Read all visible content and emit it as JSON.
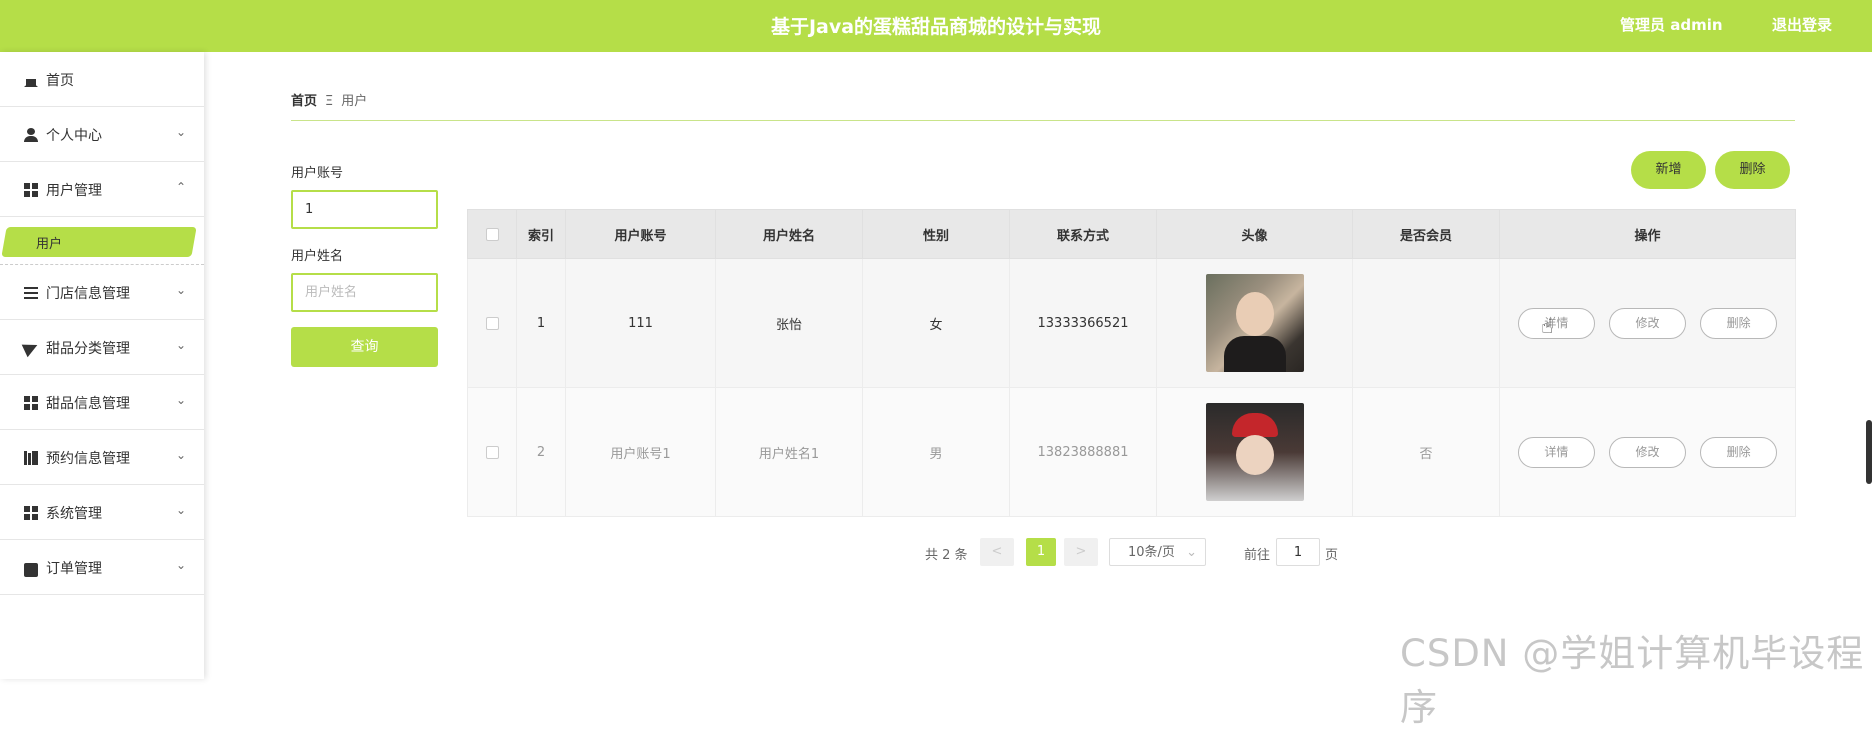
{
  "header": {
    "title": "基于Java的蛋糕甜品商城的设计与实现",
    "user": "管理员 admin",
    "logout": "退出登录",
    "accent": "#b5de48"
  },
  "sidebar": {
    "items": [
      {
        "label": "首页",
        "icon": "home-icon"
      },
      {
        "label": "个人中心",
        "icon": "user-icon"
      },
      {
        "label": "用户管理",
        "icon": "grid-icon"
      },
      {
        "label": "门店信息管理",
        "icon": "list-icon"
      },
      {
        "label": "甜品分类管理",
        "icon": "send-icon"
      },
      {
        "label": "甜品信息管理",
        "icon": "grid-icon"
      },
      {
        "label": "预约信息管理",
        "icon": "book-icon"
      },
      {
        "label": "系统管理",
        "icon": "grid-icon"
      },
      {
        "label": "订单管理",
        "icon": "ticket-icon"
      }
    ],
    "sub_active": "用户"
  },
  "breadcrumb": {
    "home": "首页",
    "current": "用户"
  },
  "search": {
    "account_label": "用户账号",
    "account_value": "1",
    "name_label": "用户姓名",
    "name_placeholder": "用户姓名",
    "button": "查询"
  },
  "actions": {
    "add": "新增",
    "delete": "删除"
  },
  "table": {
    "headers": [
      "索引",
      "用户账号",
      "用户姓名",
      "性别",
      "联系方式",
      "头像",
      "是否会员",
      "操作"
    ],
    "rows": [
      {
        "index": "1",
        "account": "111",
        "name": "张怡",
        "gender": "女",
        "phone": "13333366521",
        "avatar": "photo-woman",
        "member": ""
      },
      {
        "index": "2",
        "account": "用户账号1",
        "name": "用户姓名1",
        "gender": "男",
        "phone": "13823888881",
        "avatar": "photo-man-red-cap",
        "member": "否"
      }
    ],
    "ops": {
      "detail": "详情",
      "edit": "修改",
      "remove": "删除"
    }
  },
  "pagination": {
    "total": "共 2 条",
    "current": "1",
    "page_size": "10条/页",
    "goto": "前往",
    "goto_value": "1",
    "page_unit": "页"
  },
  "watermark": "CSDN @学姐计算机毕设程序"
}
